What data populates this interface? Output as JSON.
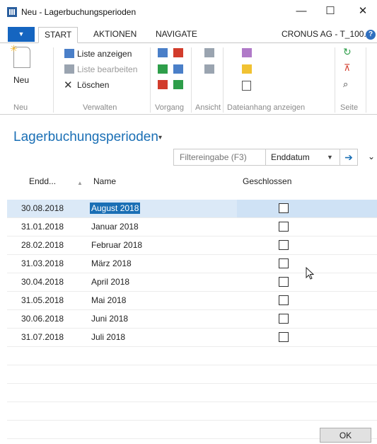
{
  "window": {
    "title": "Neu - Lagerbuchungsperioden",
    "minimize": "—",
    "maximize": "☐",
    "close": "✕"
  },
  "ribbon": {
    "tabs": [
      "START",
      "AKTIONEN",
      "NAVIGATE"
    ],
    "company": "CRONUS AG - T_100...",
    "neu_label": "Neu",
    "items": {
      "liste_anzeigen": "Liste anzeigen",
      "liste_bearbeiten": "Liste bearbeiten",
      "loeschen": "Löschen"
    },
    "groups": [
      "Neu",
      "Verwalten",
      "Vorgang",
      "Ansicht",
      "Dateianhang anzeigen",
      "Seite"
    ]
  },
  "page": {
    "title": "Lagerbuchungsperioden",
    "filter_placeholder": "Filtereingabe (F3)",
    "filter_field": "Enddatum"
  },
  "table": {
    "headers": {
      "date": "Endd...",
      "name": "Name",
      "closed": "Geschlossen"
    },
    "rows": [
      {
        "date": "30.08.2018",
        "name": "August 2018",
        "closed": false
      },
      {
        "date": "31.01.2018",
        "name": "Januar 2018",
        "closed": false
      },
      {
        "date": "28.02.2018",
        "name": "Februar 2018",
        "closed": false
      },
      {
        "date": "31.03.2018",
        "name": "März 2018",
        "closed": false
      },
      {
        "date": "30.04.2018",
        "name": "April 2018",
        "closed": false
      },
      {
        "date": "31.05.2018",
        "name": "Mai 2018",
        "closed": false
      },
      {
        "date": "30.06.2018",
        "name": "Juni 2018",
        "closed": false
      },
      {
        "date": "31.07.2018",
        "name": "Juli 2018",
        "closed": false
      }
    ],
    "selected_row": 0
  },
  "footer": {
    "ok_label": "OK"
  }
}
